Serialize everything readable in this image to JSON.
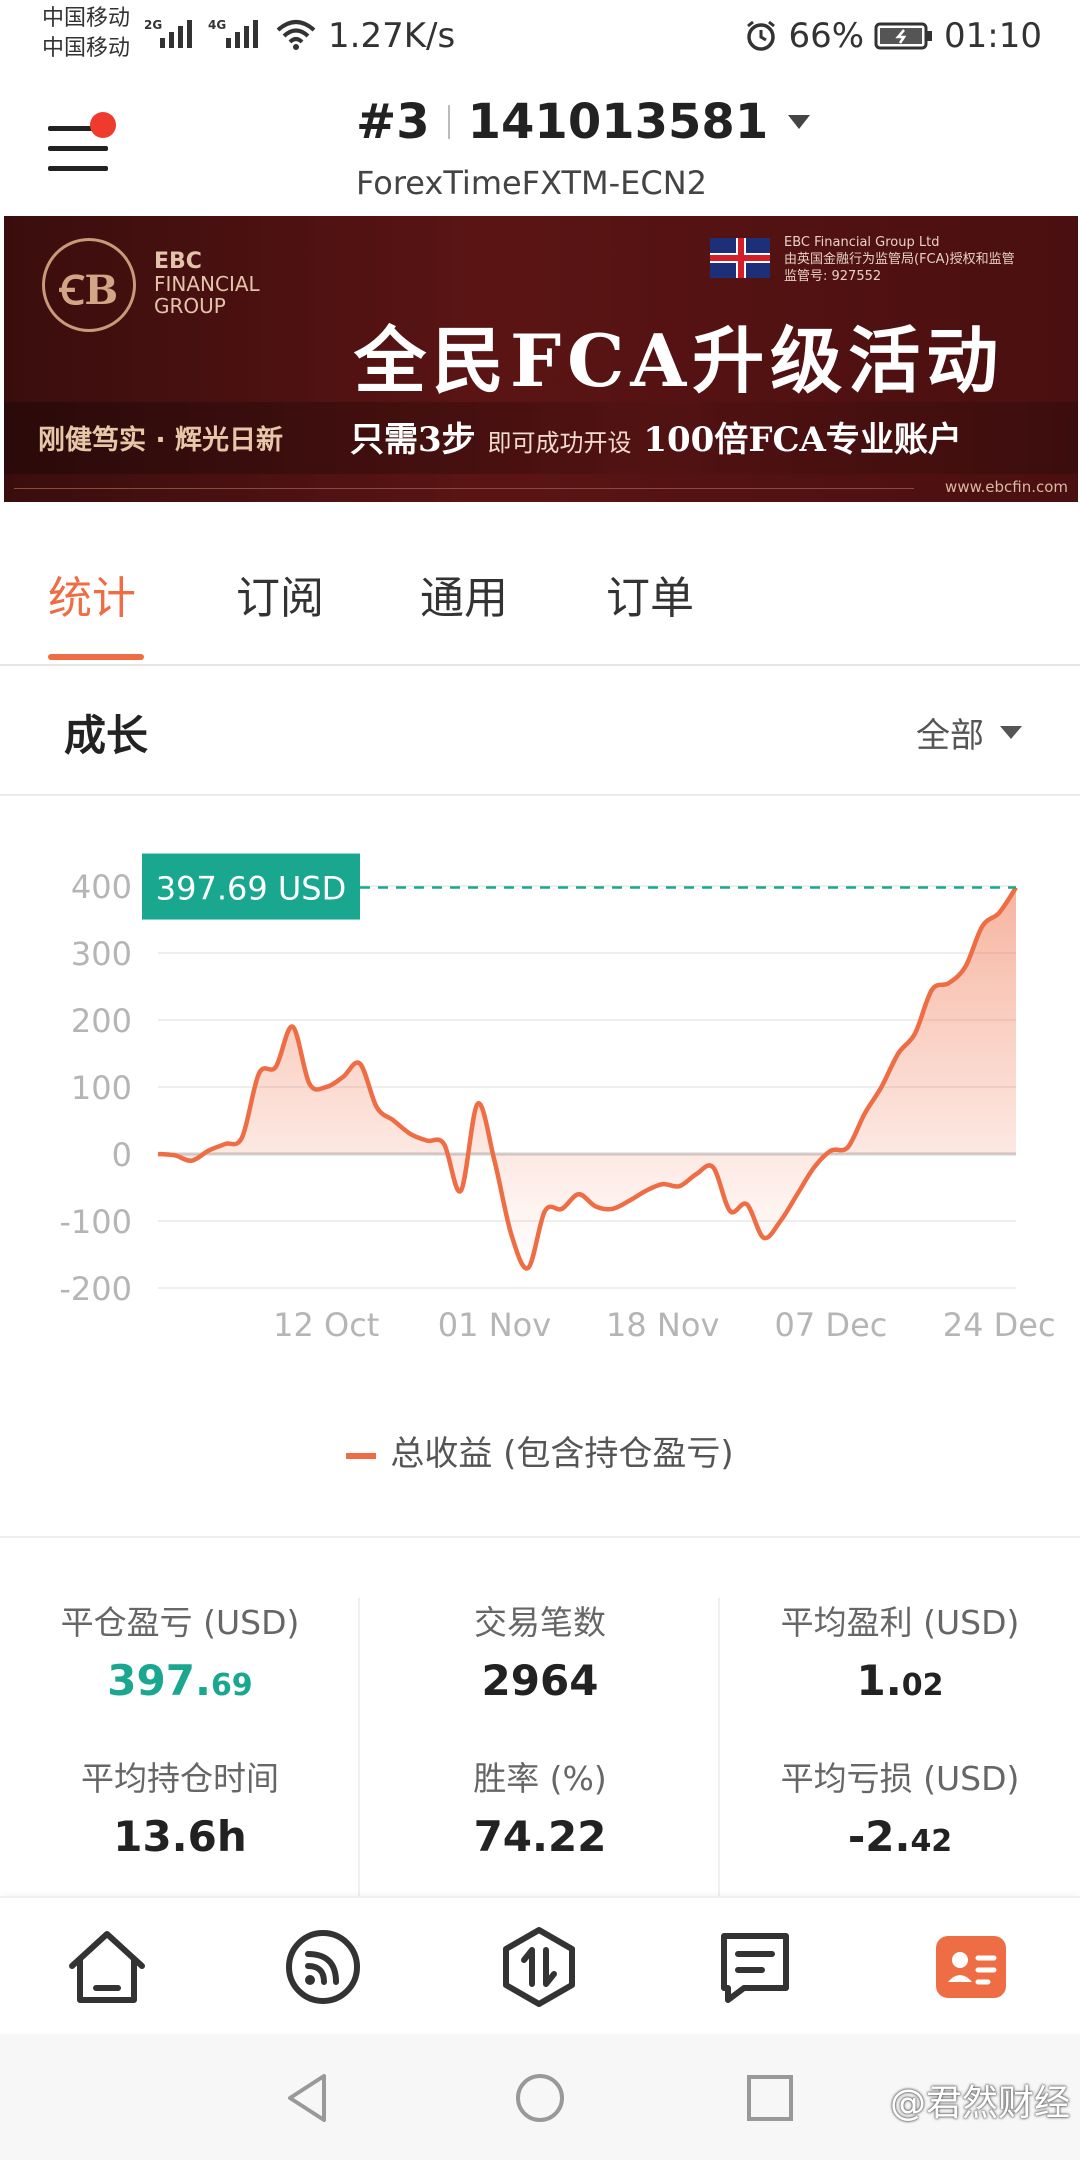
{
  "status_bar": {
    "carrier1": "中国移动",
    "carrier2": "中国移动",
    "net1": "2G",
    "net2": "4G",
    "speed": "1.27K/s",
    "battery": "66%",
    "time": "01:10"
  },
  "header": {
    "account_no": "#3",
    "account_id": "141013581",
    "server": "ForexTimeFXTM-ECN2",
    "notification_dot": true
  },
  "banner": {
    "brand": "EBC",
    "brand_line1": "FINANCIAL",
    "brand_line2": "GROUP",
    "reg_line1": "EBC Financial Group Ltd",
    "reg_line2": "由英国金融行为监管局(FCA)授权和监管",
    "reg_line3": "监管号: 927552",
    "headline": "全民FCA升级活动",
    "slogan": "刚健笃实 · 辉光日新",
    "promo_a": "只需3步",
    "promo_b": "即可成功开设",
    "promo_c": "100倍FCA专业账户",
    "url": "www.ebcfin.com"
  },
  "tabs": [
    {
      "label": "统计",
      "active": true
    },
    {
      "label": "订阅",
      "active": false
    },
    {
      "label": "通用",
      "active": false
    },
    {
      "label": "订单",
      "active": false
    }
  ],
  "growth": {
    "title": "成长",
    "range_label": "全部"
  },
  "chart_data": {
    "type": "area",
    "title": "",
    "xlabel": "",
    "ylabel": "",
    "ylim": [
      -200,
      400
    ],
    "y_ticks": [
      400,
      300,
      200,
      100,
      0,
      -100,
      -200
    ],
    "x_tick_labels": [
      "12 Oct",
      "01 Nov",
      "18 Nov",
      "07 Dec",
      "24 Dec"
    ],
    "x_tick_index": [
      10,
      20,
      30,
      40,
      50
    ],
    "current_value_label": "397.69 USD",
    "current_value": 397.69,
    "series": [
      {
        "name": "总收益 (包含持仓盈亏)",
        "color": "#ee6d45",
        "values": [
          0,
          -2,
          -10,
          5,
          15,
          25,
          120,
          130,
          190,
          105,
          100,
          115,
          135,
          70,
          50,
          30,
          20,
          15,
          -55,
          75,
          -10,
          -120,
          -170,
          -85,
          -82,
          -60,
          -78,
          -82,
          -70,
          -55,
          -45,
          -48,
          -30,
          -20,
          -85,
          -75,
          -125,
          -100,
          -60,
          -20,
          5,
          10,
          60,
          100,
          150,
          180,
          245,
          255,
          280,
          340,
          360,
          397.69
        ]
      }
    ]
  },
  "legend": {
    "label": "总收益 (包含持仓盈亏)"
  },
  "stats": {
    "closed_pl_label": "平仓盈亏 (USD)",
    "closed_pl_int": "397.",
    "closed_pl_dec": "69",
    "trades_label": "交易笔数",
    "trades_value": "2964",
    "avg_profit_label": "平均盈利 (USD)",
    "avg_profit_int": "1.",
    "avg_profit_dec": "02",
    "avg_hold_label": "平均持仓时间",
    "avg_hold_value": "13.6h",
    "win_rate_label": "胜率 (%)",
    "win_rate_value": "74.22",
    "avg_loss_label": "平均亏损 (USD)",
    "avg_loss_int": "-2.",
    "avg_loss_dec": "42"
  },
  "bottom_nav": [
    {
      "icon": "home-icon",
      "active": false
    },
    {
      "icon": "signal-feed-icon",
      "active": false
    },
    {
      "icon": "trade-icon",
      "active": false
    },
    {
      "icon": "news-icon",
      "active": false
    },
    {
      "icon": "profile-card-icon",
      "active": true
    }
  ],
  "watermark": "@君然财经",
  "colors": {
    "accent": "#ee6d45",
    "green": "#19a78f"
  }
}
